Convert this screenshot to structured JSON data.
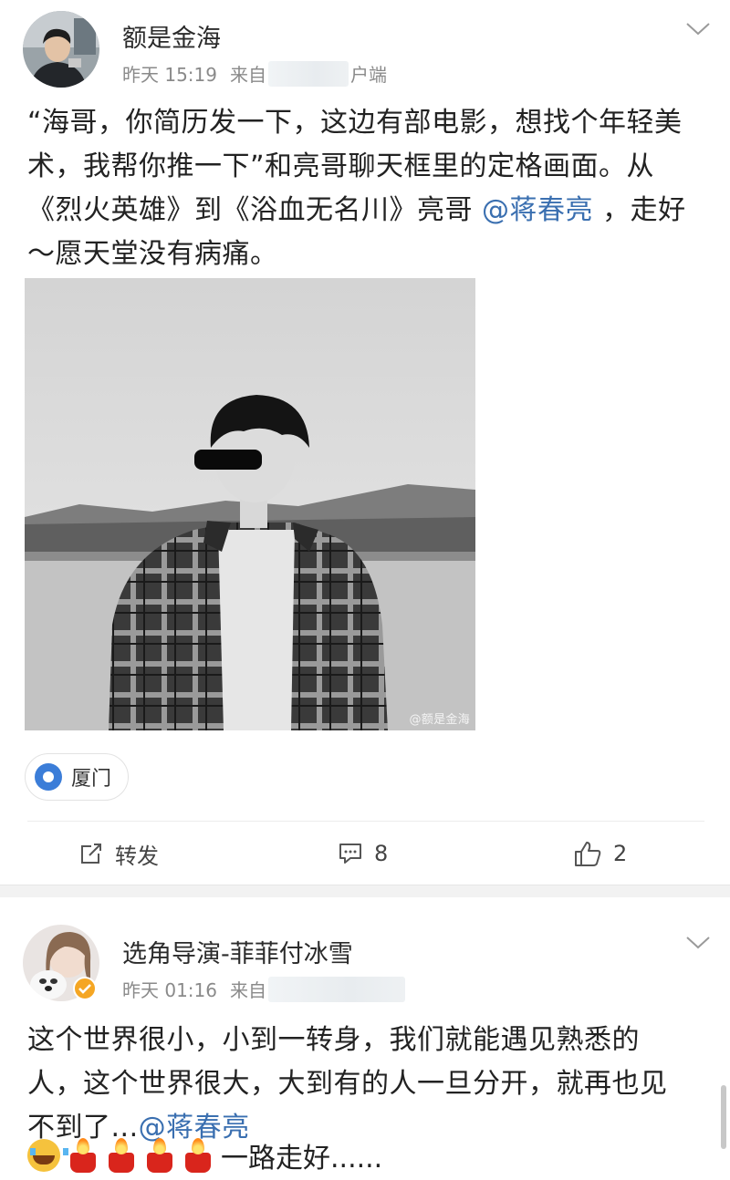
{
  "post1": {
    "username": "额是金海",
    "time": "昨天 15:19",
    "source_prefix": "来自",
    "source_suffix": "户端",
    "text_lines": [
      "“海哥，你简历发一下，这边有部电影，想找个年轻美",
      "术，我帮你推一下”和亮哥聊天框里的定格画面。从",
      "《烈火英雄》到《浴血无名川》亮哥 ",
      "～愿天堂没有病痛。"
    ],
    "mention": "@蒋春亮",
    "line3_tail": " ，走好",
    "photo_watermark": "@额是金海",
    "location": "厦门",
    "actions": {
      "repost_label": "转发",
      "comment_count": "8",
      "like_count": "2"
    }
  },
  "post2": {
    "username": "选角导演-菲菲付冰雪",
    "time": "昨天 01:16",
    "source_prefix": "来自",
    "text_lines": [
      "这个世界很小，小到一转身，我们就能遇见熟悉的",
      "人，这个世界很大，大到有的人一旦分开，就再也见",
      "不到了..."
    ],
    "mention": "@蒋春亮",
    "emoji_tail": "一路走好......",
    "emojis": [
      "cry-face",
      "candle",
      "candle",
      "candle",
      "candle"
    ]
  },
  "colors": {
    "mention": "#3a6fb0",
    "location_pin": "#3b7dd8",
    "verified_badge": "#f5a623"
  }
}
